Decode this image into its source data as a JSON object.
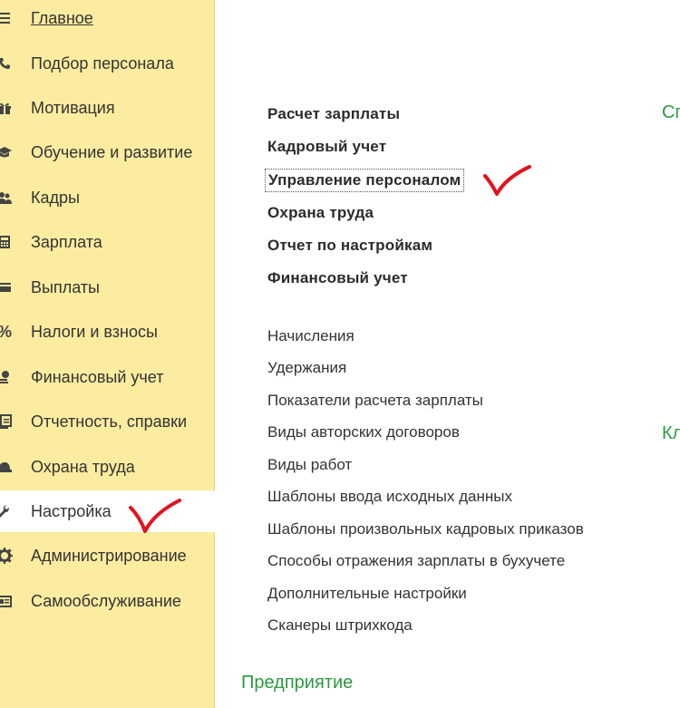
{
  "sidebar": {
    "items": [
      {
        "label": "Главное",
        "icon": "menu-icon"
      },
      {
        "label": "Подбор персонала",
        "icon": "phone-icon"
      },
      {
        "label": "Мотивация",
        "icon": "gift-icon"
      },
      {
        "label": "Обучение и развитие",
        "icon": "graduation-cap-icon"
      },
      {
        "label": "Кадры",
        "icon": "people-icon"
      },
      {
        "label": "Зарплата",
        "icon": "calculator-icon"
      },
      {
        "label": "Выплаты",
        "icon": "card-icon"
      },
      {
        "label": "Налоги и взносы",
        "icon": "percent-icon"
      },
      {
        "label": "Финансовый учет",
        "icon": "coins-icon"
      },
      {
        "label": "Отчетность, справки",
        "icon": "report-icon"
      },
      {
        "label": "Охрана труда",
        "icon": "helmet-icon"
      },
      {
        "label": "Настройка",
        "icon": "wrench-icon"
      },
      {
        "label": "Администрирование",
        "icon": "gear-icon"
      },
      {
        "label": "Самообслуживание",
        "icon": "id-card-icon"
      }
    ],
    "active_item": "Настройка"
  },
  "main": {
    "bold_links": [
      "Расчет зарплаты",
      "Кадровый учет",
      "Управление персоналом",
      "Охрана труда",
      "Отчет по настройкам",
      "Финансовый учет"
    ],
    "focused_link": "Управление персоналом",
    "links": [
      "Начисления",
      "Удержания",
      "Показатели расчета зарплаты",
      "Виды авторских договоров",
      "Виды работ",
      "Шаблоны ввода исходных данных",
      "Шаблоны произвольных кадровых приказов",
      "Способы отражения зарплаты в бухучете",
      "Дополнительные настройки",
      "Сканеры штрихкода"
    ],
    "section_heading": "Предприятие",
    "right_clipped_top": "Сп",
    "right_clipped_mid": "Кл"
  },
  "colors": {
    "sidebar_bg": "#fbeca0",
    "accent_green": "#2a9a3f",
    "annotation_red": "#e0141e"
  }
}
